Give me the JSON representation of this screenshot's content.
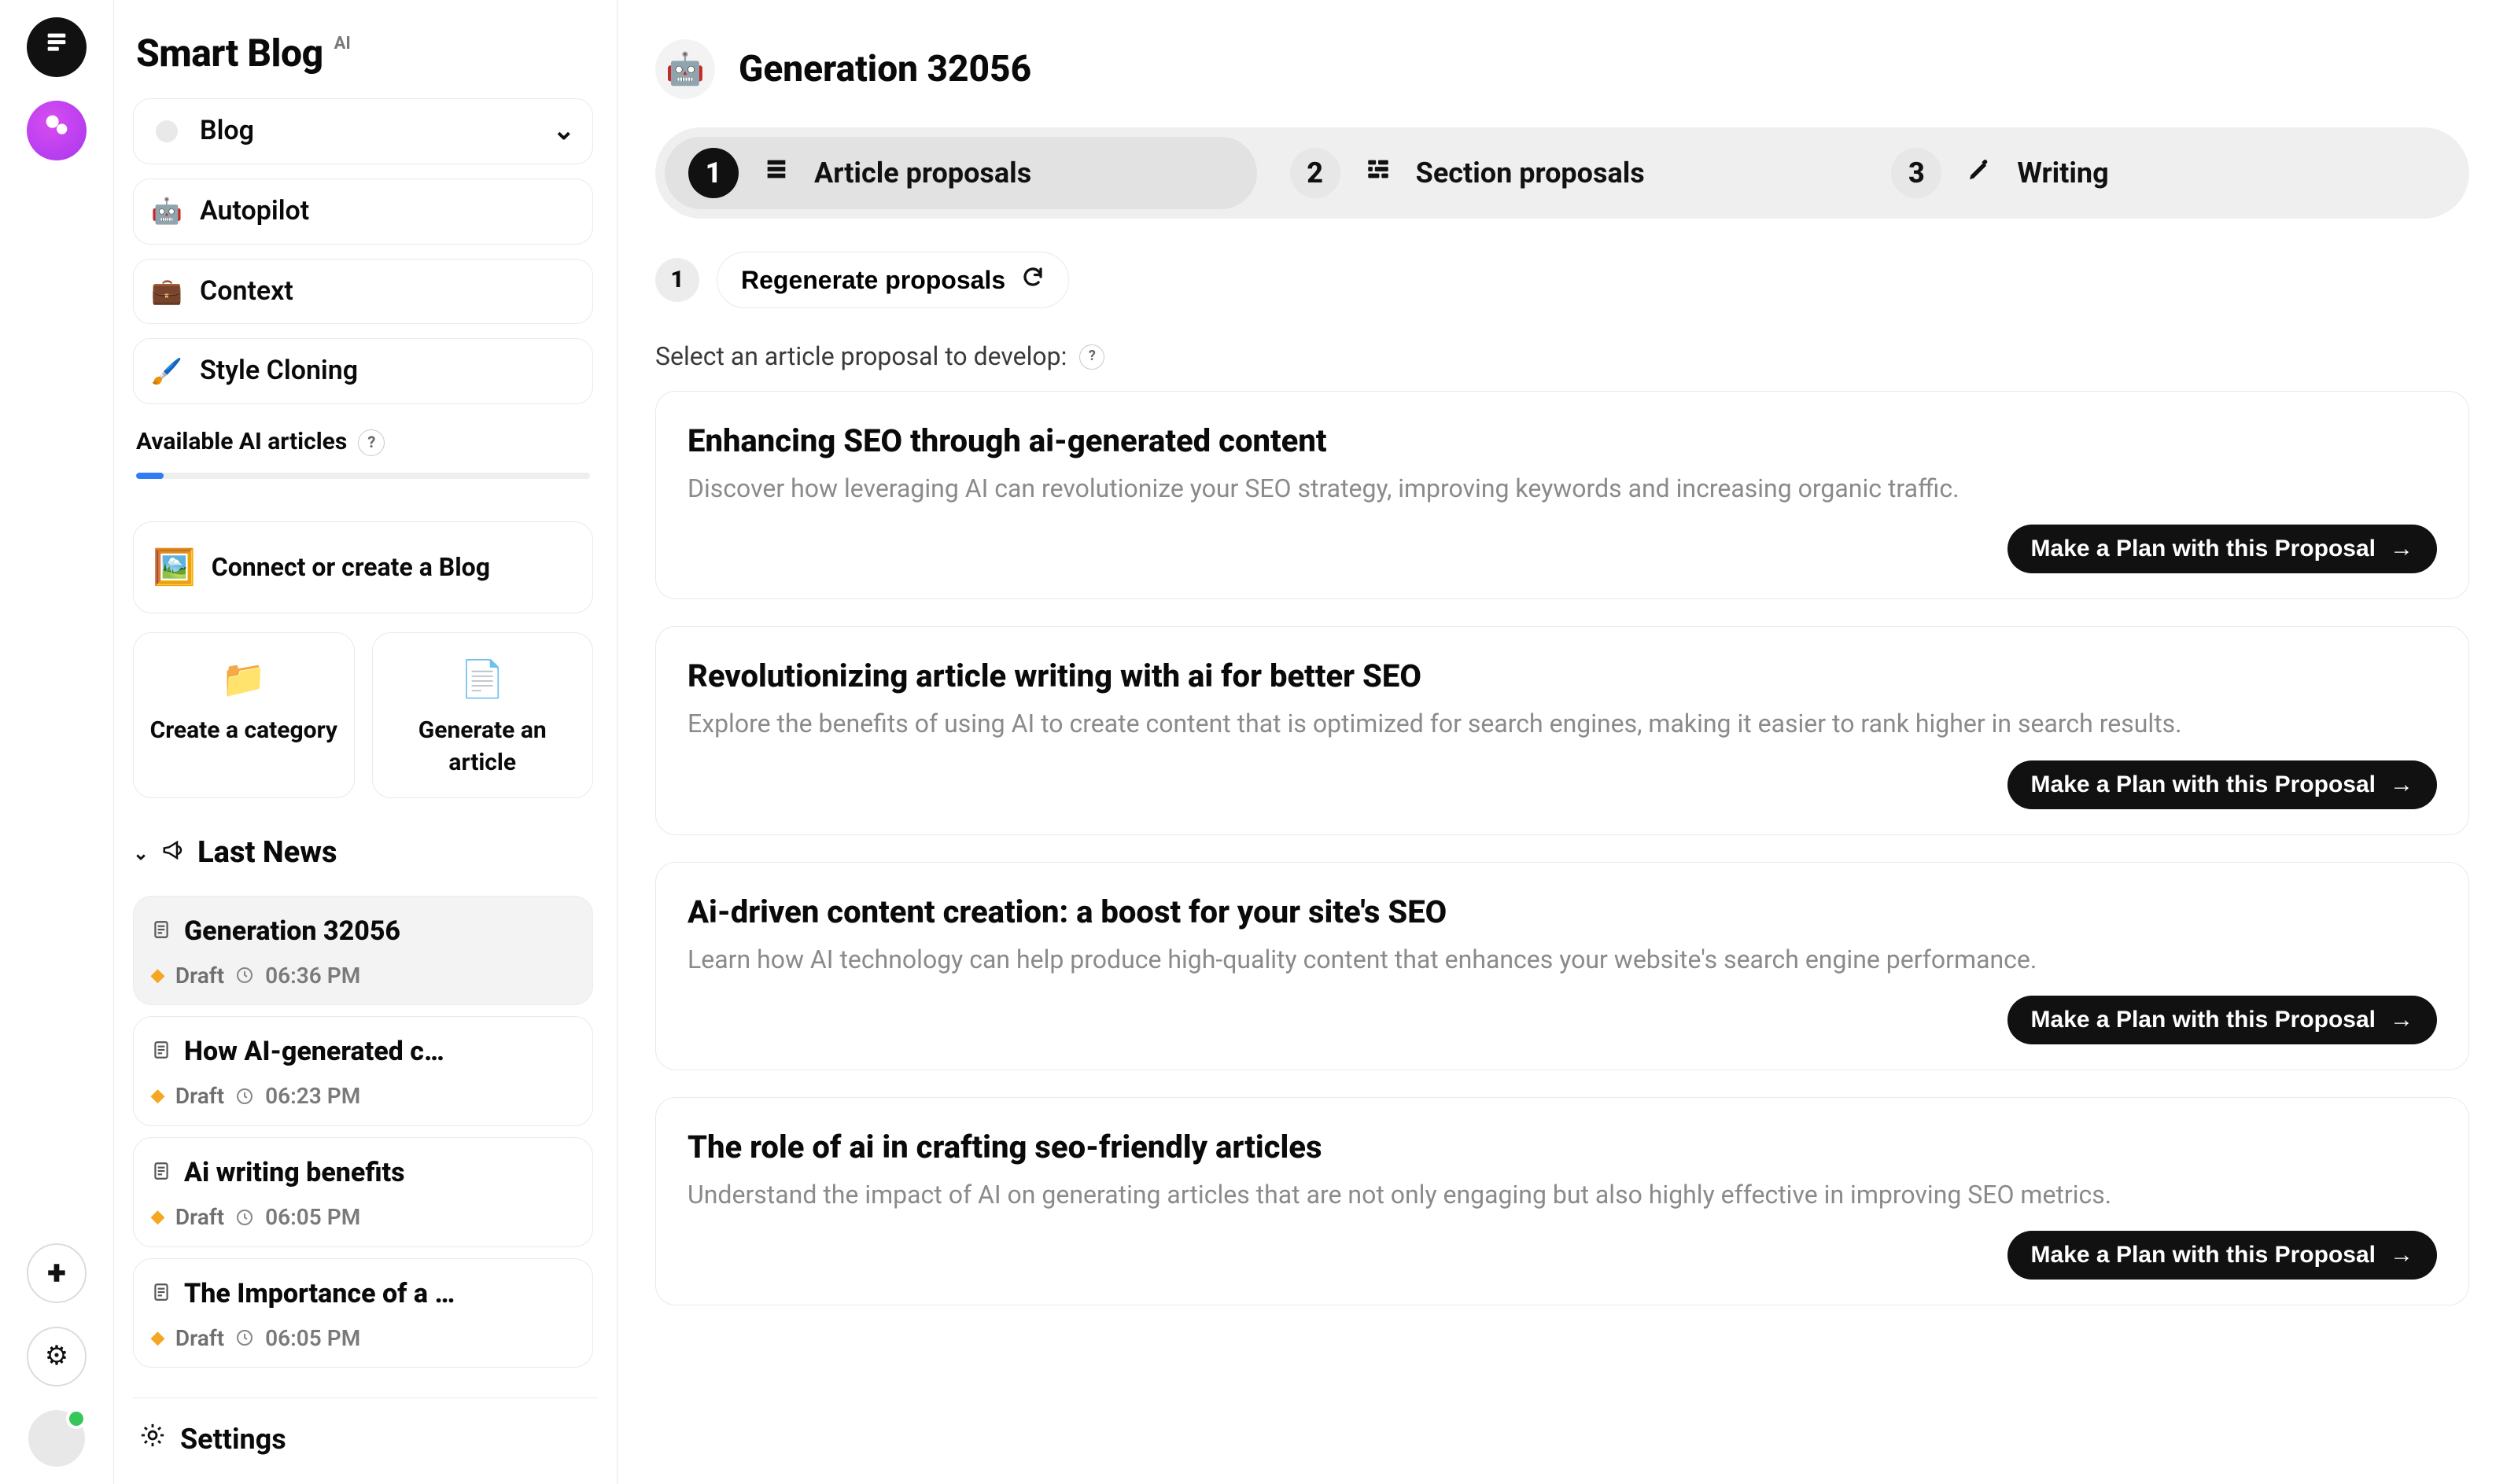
{
  "brand": {
    "name": "Smart Blog",
    "badge": "AI"
  },
  "rail": {
    "stack_icon": "≡",
    "pink_icon": "✦",
    "plus_icon": "+",
    "gear_icon": "⚙",
    "avatar_status": "online"
  },
  "nav": {
    "blog": {
      "label": "Blog",
      "icon": "•",
      "chevron": "˅"
    },
    "autopilot": {
      "label": "Autopilot",
      "icon": "🤖"
    },
    "context": {
      "label": "Context",
      "icon": "💼"
    },
    "styleclone": {
      "label": "Style Cloning",
      "icon": "🖌️"
    }
  },
  "quota": {
    "label": "Available AI articles",
    "help": "?",
    "progress_pct": 6
  },
  "connect": {
    "label": "Connect or create a Blog",
    "icon": "🖼️"
  },
  "actions": {
    "create_category": {
      "label": "Create a category",
      "icon": "📁"
    },
    "generate_article": {
      "label": "Generate an article",
      "icon": "📄"
    }
  },
  "last_news": {
    "heading": "Last News",
    "items": [
      {
        "title": "Generation 32056",
        "status": "Draft",
        "time": "06:36 PM",
        "active": true
      },
      {
        "title": "How AI-generated c…",
        "status": "Draft",
        "time": "06:23 PM",
        "active": false
      },
      {
        "title": "Ai writing benefits",
        "status": "Draft",
        "time": "06:05 PM",
        "active": false
      },
      {
        "title": "The Importance of a …",
        "status": "Draft",
        "time": "06:05 PM",
        "active": false
      }
    ]
  },
  "settings_label": "Settings",
  "generation": {
    "icon": "🤖",
    "title": "Generation 32056"
  },
  "steps": {
    "s1": {
      "num": "1",
      "label": "Article proposals"
    },
    "s2": {
      "num": "2",
      "label": "Section proposals"
    },
    "s3": {
      "num": "3",
      "label": "Writing"
    }
  },
  "toolbar": {
    "count": "1",
    "regenerate_label": "Regenerate proposals"
  },
  "hint": {
    "text": "Select an article proposal to develop:",
    "help": "?"
  },
  "cta_label": "Make a Plan with this Proposal",
  "proposals": [
    {
      "title": "Enhancing SEO through ai-generated content",
      "subtitle": "Discover how leveraging AI can revolutionize your SEO strategy, improving keywords and increasing organic traffic."
    },
    {
      "title": "Revolutionizing article writing with ai for better SEO",
      "subtitle": "Explore the benefits of using AI to create content that is optimized for search engines, making it easier to rank higher in search results."
    },
    {
      "title": "Ai-driven content creation: a boost for your site's SEO",
      "subtitle": "Learn how AI technology can help produce high-quality content that enhances your website's search engine performance."
    },
    {
      "title": "The role of ai in crafting seo-friendly articles",
      "subtitle": "Understand the impact of AI on generating articles that are not only engaging but also highly effective in improving SEO metrics."
    }
  ]
}
